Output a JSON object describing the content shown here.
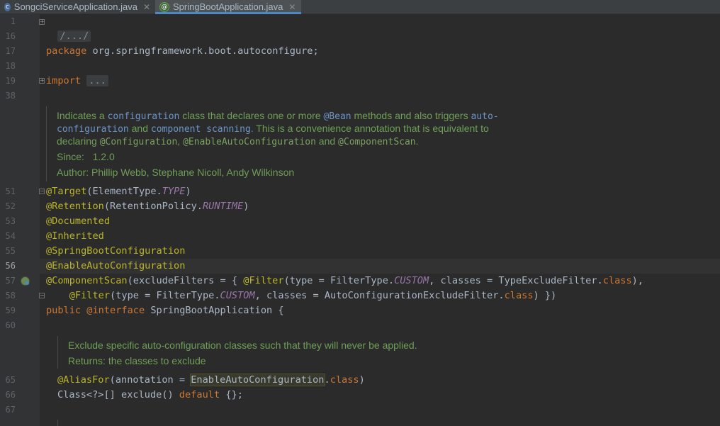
{
  "tabs": [
    {
      "label": "SongciServiceApplication.java",
      "active": false
    },
    {
      "label": "SpringBootApplication.java",
      "active": true
    }
  ],
  "gutter": {
    "line_numbers": [
      "1",
      "16",
      "17",
      "18",
      "19",
      "38",
      "51",
      "52",
      "53",
      "54",
      "55",
      "56",
      "57",
      "58",
      "59",
      "60",
      "65",
      "66",
      "67"
    ],
    "current_line": "56"
  },
  "code": {
    "l1": "/.../",
    "l17_kw": "package",
    "l17_rest": " org.springframework.boot.autoconfigure;",
    "l19_kw": "import",
    "l19_fold": "...",
    "l51_an": "@Target",
    "l51_a": "(ElementType.",
    "l51_i": "TYPE",
    "l51_b": ")",
    "l52_an": "@Retention",
    "l52_a": "(RetentionPolicy.",
    "l52_i": "RUNTIME",
    "l52_b": ")",
    "l53": "@Documented",
    "l54": "@Inherited",
    "l55": "@SpringBootConfiguration",
    "l56": "@EnableAutoConfiguration",
    "l57_an": "@ComponentScan",
    "l57_a": "(excludeFilters = { ",
    "l57_an2": "@Filter",
    "l57_b": "(type = FilterType.",
    "l57_i": "CUSTOM",
    "l57_c": ", classes = TypeExcludeFilter.",
    "l57_kw": "class",
    "l57_d": "),",
    "l58_pre": "    ",
    "l58_an": "@Filter",
    "l58_a": "(type = FilterType.",
    "l58_i": "CUSTOM",
    "l58_b": ", classes = AutoConfigurationExcludeFilter.",
    "l58_kw": "class",
    "l58_c": ") })",
    "l59_kw": "public ",
    "l59_an": "@interface",
    "l59_rest": " SpringBootApplication {",
    "l65_an": "@AliasFor",
    "l65_a": "(annotation = ",
    "l65_mark": "EnableAutoConfiguration",
    "l65_b": ".",
    "l65_kw": "class",
    "l65_c": ")",
    "l66_a": "Class<?>[] exclude() ",
    "l66_kw": "default",
    "l66_b": " {};"
  },
  "doc1": {
    "l1_a": "Indicates a ",
    "l1_m1": "configuration",
    "l1_b": " class that declares one or more ",
    "l1_m2": "@Bean",
    "l1_c": " methods and also triggers ",
    "l1_m3": "auto-",
    "l2_m1": "configuration",
    "l2_a": " and ",
    "l2_m2": "component scanning",
    "l2_b": ". This is a convenience annotation that is equivalent to",
    "l3_a": "declaring ",
    "l3_m1": "@Configuration",
    "l3_b": ", ",
    "l3_m2": "@EnableAutoConfiguration",
    "l3_c": " and ",
    "l3_m3": "@ComponentScan",
    "l3_d": ".",
    "since_label": "Since:",
    "since_value": "1.2.0",
    "author_label": "Author:",
    "author_value": "Phillip Webb, Stephane Nicoll, Andy Wilkinson"
  },
  "doc2": {
    "l1": "Exclude specific auto-configuration classes such that they will never be applied.",
    "returns_label": "Returns:",
    "returns_value": "the classes to exclude"
  },
  "colors": {
    "background": "#2b2b2b",
    "keyword": "#cc7832",
    "annotation": "#bbb529",
    "constant": "#9876aa",
    "doc_text": "#6e9f57",
    "tab_underline": "#4a88c7"
  }
}
